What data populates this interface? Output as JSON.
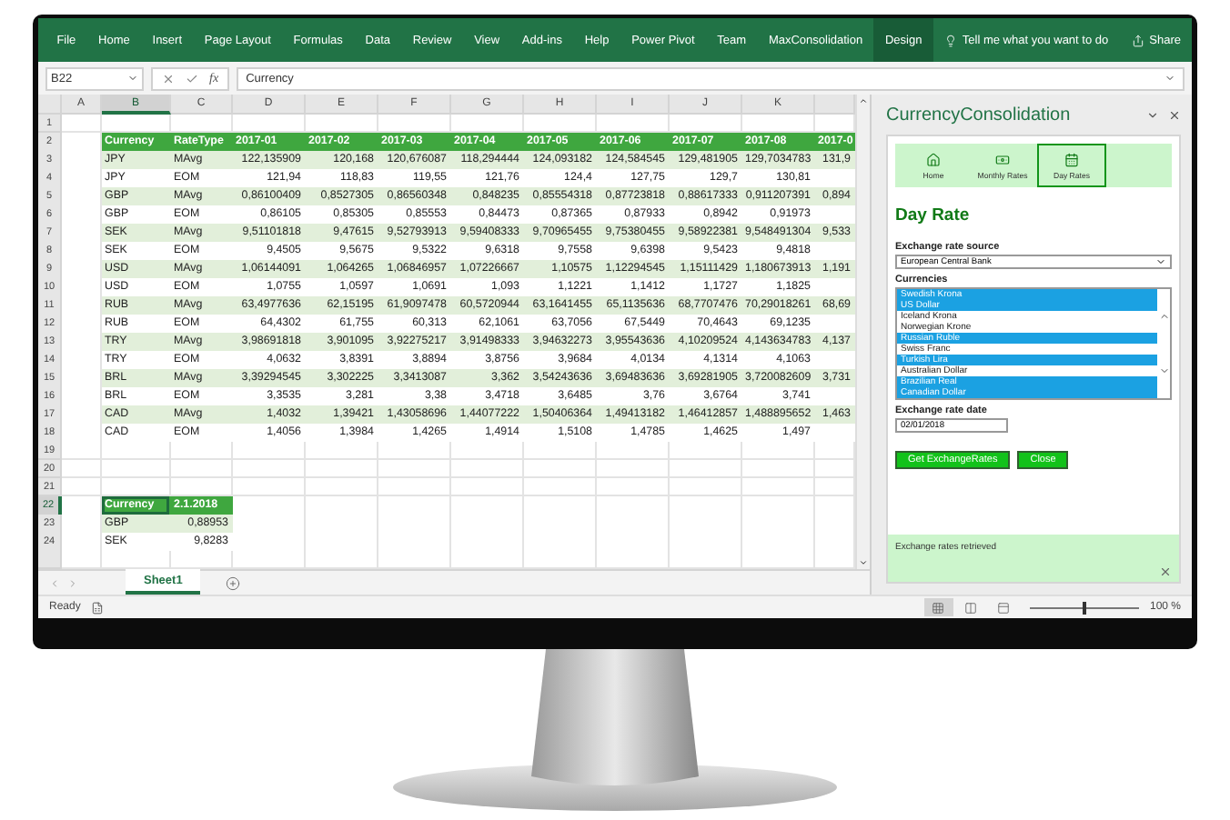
{
  "ribbon": {
    "tabs": [
      {
        "label": "File",
        "selected": false
      },
      {
        "label": "Home",
        "selected": false
      },
      {
        "label": "Insert",
        "selected": false
      },
      {
        "label": "Page Layout",
        "selected": false
      },
      {
        "label": "Formulas",
        "selected": false
      },
      {
        "label": "Data",
        "selected": false
      },
      {
        "label": "Review",
        "selected": false
      },
      {
        "label": "View",
        "selected": false
      },
      {
        "label": "Add-ins",
        "selected": false
      },
      {
        "label": "Help",
        "selected": false
      },
      {
        "label": "Power Pivot",
        "selected": false
      },
      {
        "label": "Team",
        "selected": false
      },
      {
        "label": "MaxConsolidation",
        "selected": false
      },
      {
        "label": "Design",
        "selected": true
      }
    ],
    "search": {
      "placeholder": "Tell me what you want to do"
    },
    "share": "Share"
  },
  "formula_bar": {
    "name_box": "B22",
    "function_label": "fx",
    "value": "Currency"
  },
  "column_headers": [
    {
      "label": "A",
      "selected": false
    },
    {
      "label": "B",
      "selected": true
    },
    {
      "label": "C",
      "selected": false
    },
    {
      "label": "D",
      "selected": false
    },
    {
      "label": "E",
      "selected": false
    },
    {
      "label": "F",
      "selected": false
    },
    {
      "label": "G",
      "selected": false
    },
    {
      "label": "H",
      "selected": false
    },
    {
      "label": "I",
      "selected": false
    },
    {
      "label": "J",
      "selected": false
    },
    {
      "label": "K",
      "selected": false
    }
  ],
  "row_numbers": [
    {
      "label": "1",
      "selected": false
    },
    {
      "label": "2",
      "selected": false
    },
    {
      "label": "3",
      "selected": false
    },
    {
      "label": "4",
      "selected": false
    },
    {
      "label": "5",
      "selected": false
    },
    {
      "label": "6",
      "selected": false
    },
    {
      "label": "7",
      "selected": false
    },
    {
      "label": "8",
      "selected": false
    },
    {
      "label": "9",
      "selected": false
    },
    {
      "label": "10",
      "selected": false
    },
    {
      "label": "11",
      "selected": false
    },
    {
      "label": "12",
      "selected": false
    },
    {
      "label": "13",
      "selected": false
    },
    {
      "label": "14",
      "selected": false
    },
    {
      "label": "15",
      "selected": false
    },
    {
      "label": "16",
      "selected": false
    },
    {
      "label": "17",
      "selected": false
    },
    {
      "label": "18",
      "selected": false
    },
    {
      "label": "19",
      "selected": false
    },
    {
      "label": "20",
      "selected": false
    },
    {
      "label": "21",
      "selected": false
    },
    {
      "label": "22",
      "selected": true
    },
    {
      "label": "23",
      "selected": false
    },
    {
      "label": "24",
      "selected": false
    }
  ],
  "table": {
    "columns": [
      "Currency",
      "RateType",
      "2017-01",
      "2017-02",
      "2017-03",
      "2017-04",
      "2017-05",
      "2017-06",
      "2017-07",
      "2017-08",
      "2017-0"
    ],
    "rows": [
      {
        "cells": [
          "JPY",
          "MAvg",
          "122,135909",
          "120,168",
          "120,676087",
          "118,294444",
          "124,093182",
          "124,584545",
          "129,481905",
          "129,7034783"
        ],
        "column_11": "131,9"
      },
      {
        "cells": [
          "JPY",
          "EOM",
          "121,94",
          "118,83",
          "119,55",
          "121,76",
          "124,4",
          "127,75",
          "129,7",
          "130,81"
        ]
      },
      {
        "cells": [
          "GBP",
          "MAvg",
          "0,86100409",
          "0,8527305",
          "0,86560348",
          "0,848235",
          "0,85554318",
          "0,87723818",
          "0,88617333",
          "0,911207391"
        ],
        "column_11": "0,894"
      },
      {
        "cells": [
          "GBP",
          "EOM",
          "0,86105",
          "0,85305",
          "0,85553",
          "0,84473",
          "0,87365",
          "0,87933",
          "0,8942",
          "0,91973"
        ]
      },
      {
        "cells": [
          "SEK",
          "MAvg",
          "9,51101818",
          "9,47615",
          "9,52793913",
          "9,59408333",
          "9,70965455",
          "9,75380455",
          "9,58922381",
          "9,548491304"
        ],
        "column_11": "9,533"
      },
      {
        "cells": [
          "SEK",
          "EOM",
          "9,4505",
          "9,5675",
          "9,5322",
          "9,6318",
          "9,7558",
          "9,6398",
          "9,5423",
          "9,4818"
        ]
      },
      {
        "cells": [
          "USD",
          "MAvg",
          "1,06144091",
          "1,064265",
          "1,06846957",
          "1,07226667",
          "1,10575",
          "1,12294545",
          "1,15111429",
          "1,180673913"
        ],
        "column_11": "1,191"
      },
      {
        "cells": [
          "USD",
          "EOM",
          "1,0755",
          "1,0597",
          "1,0691",
          "1,093",
          "1,1221",
          "1,1412",
          "1,1727",
          "1,1825"
        ]
      },
      {
        "cells": [
          "RUB",
          "MAvg",
          "63,4977636",
          "62,15195",
          "61,9097478",
          "60,5720944",
          "63,1641455",
          "65,1135636",
          "68,7707476",
          "70,29018261"
        ],
        "column_11": "68,69"
      },
      {
        "cells": [
          "RUB",
          "EOM",
          "64,4302",
          "61,755",
          "60,313",
          "62,1061",
          "63,7056",
          "67,5449",
          "70,4643",
          "69,1235"
        ]
      },
      {
        "cells": [
          "TRY",
          "MAvg",
          "3,98691818",
          "3,901095",
          "3,92275217",
          "3,91498333",
          "3,94632273",
          "3,95543636",
          "4,10209524",
          "4,143634783"
        ],
        "column_11": "4,137"
      },
      {
        "cells": [
          "TRY",
          "EOM",
          "4,0632",
          "3,8391",
          "3,8894",
          "3,8756",
          "3,9684",
          "4,0134",
          "4,1314",
          "4,1063"
        ]
      },
      {
        "cells": [
          "BRL",
          "MAvg",
          "3,39294545",
          "3,302225",
          "3,3413087",
          "3,362",
          "3,54243636",
          "3,69483636",
          "3,69281905",
          "3,720082609"
        ],
        "column_11": "3,731"
      },
      {
        "cells": [
          "BRL",
          "EOM",
          "3,3535",
          "3,281",
          "3,38",
          "3,4718",
          "3,6485",
          "3,76",
          "3,6764",
          "3,741"
        ]
      },
      {
        "cells": [
          "CAD",
          "MAvg",
          "1,4032",
          "1,39421",
          "1,43058696",
          "1,44077222",
          "1,50406364",
          "1,49413182",
          "1,46412857",
          "1,488895652"
        ],
        "column_11": "1,463"
      },
      {
        "cells": [
          "CAD",
          "EOM",
          "1,4056",
          "1,3984",
          "1,4265",
          "1,4914",
          "1,5108",
          "1,4785",
          "1,4625",
          "1,497"
        ]
      }
    ]
  },
  "table_2": {
    "columns": [
      "Currency",
      "2.1.2018"
    ],
    "rows": [
      [
        "GBP",
        "0,88953"
      ],
      [
        "SEK",
        "9,8283"
      ]
    ]
  },
  "sheet_tabs": [
    {
      "label": "Sheet1",
      "selected": true
    }
  ],
  "status_bar": {
    "status": "Ready",
    "views": [
      {
        "kind": "normal",
        "selected": true
      },
      {
        "kind": "page-layout",
        "selected": false
      },
      {
        "kind": "page-break",
        "selected": false
      }
    ],
    "zoom": {
      "level": 0.5,
      "reading": "100 %"
    }
  },
  "pane": {
    "title": "CurrencyConsolidation",
    "tabs": [
      {
        "label": "Home",
        "kind": "home",
        "selected": false
      },
      {
        "label": "Monthly Rates",
        "kind": "money",
        "selected": false
      },
      {
        "label": "Day Rates",
        "kind": "calendar",
        "selected": true
      }
    ],
    "heading": "Day Rate",
    "source": {
      "label": "Exchange rate source",
      "value": "European Central Bank"
    },
    "currencies": {
      "label": "Currencies",
      "items": [
        {
          "label": "Swedish Krona",
          "selected": true
        },
        {
          "label": "US Dollar",
          "selected": true
        },
        {
          "label": "Iceland Krona",
          "selected": false
        },
        {
          "label": "Norwegian Krone",
          "selected": false
        },
        {
          "label": "Russian Ruble",
          "selected": true
        },
        {
          "label": "Swiss Franc",
          "selected": false
        },
        {
          "label": "Turkish Lira",
          "selected": true
        },
        {
          "label": "Australian Dollar",
          "selected": false
        },
        {
          "label": "Brazilian Real",
          "selected": true
        },
        {
          "label": "Canadian Dollar",
          "selected": true
        }
      ]
    },
    "date": {
      "label": "Exchange rate date",
      "value": "02/01/2018"
    },
    "buttons": [
      "Get ExchangeRates",
      "Close"
    ],
    "message": "Exchange rates retrieved"
  }
}
